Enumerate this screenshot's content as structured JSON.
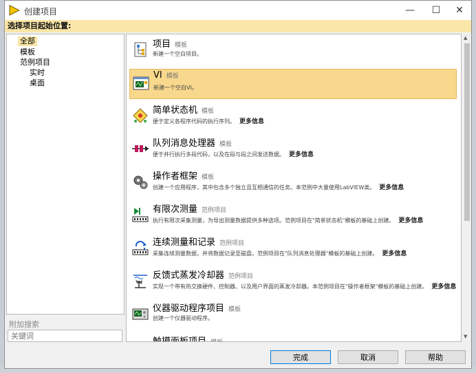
{
  "window": {
    "title": "创建项目",
    "min_glyph": "—",
    "max_glyph": "☐",
    "close_glyph": "✕"
  },
  "start_label": "选择项目起始位置:",
  "tree": {
    "items": [
      {
        "label": "全部",
        "selected": true
      },
      {
        "label": "模板"
      },
      {
        "label": "范例项目"
      },
      {
        "label": "实时"
      },
      {
        "label": "桌面"
      }
    ]
  },
  "search": {
    "label": "附加搜索",
    "placeholder": "关键词"
  },
  "templates": [
    {
      "name": "项目",
      "type": "模板",
      "desc": "新建一个空白项目。",
      "more": ""
    },
    {
      "name": "VI",
      "type": "模板",
      "desc": "新建一个空白VI。",
      "more": ""
    },
    {
      "name": "简单状态机",
      "type": "模板",
      "desc": "便于定义各程序代码的执行序列。",
      "more": "更多信息"
    },
    {
      "name": "队列消息处理器",
      "type": "模板",
      "desc": "便于并行执行多段代码，以及在段与段之间发送数据。",
      "more": "更多信息"
    },
    {
      "name": "操作者框架",
      "type": "模板",
      "desc": "创建一个应用程序，其中包含多个独立且互相通信的任务。本范例中大量使用LabVIEW类。",
      "more": "更多信息"
    },
    {
      "name": "有限次测量",
      "type": "范例项目",
      "desc": "执行有限次采集测量，为导出测量数据提供多种选项。范例项目在\"简单状态机\"模板的基础上创建。",
      "more": "更多信息"
    },
    {
      "name": "连续测量和记录",
      "type": "范例项目",
      "desc": "采集连续测量数据，并将数据记录至磁盘。范例项目在\"队列消息处理器\"模板的基础上创建。",
      "more": "更多信息"
    },
    {
      "name": "反馈式蒸发冷却器",
      "type": "范例项目",
      "desc": "实现一个带有热交换硬件、控制器、以及用户界面的蒸发冷却器。本范例项目在\"操作者框架\"模板的基础上创建。",
      "more": "更多信息"
    },
    {
      "name": "仪器驱动程序项目",
      "type": "模板",
      "desc": "创建一个仪器驱动程序。",
      "more": ""
    },
    {
      "name": "触摸面板项目",
      "type": "模板",
      "desc": "",
      "more": ""
    }
  ],
  "buttons": {
    "finish": "完成",
    "cancel": "取消",
    "help": "帮助"
  },
  "colors": {
    "header_bg": "#f9e6a8",
    "selected_item_bg": "#f8d88c",
    "primary_border": "#0078d7"
  }
}
